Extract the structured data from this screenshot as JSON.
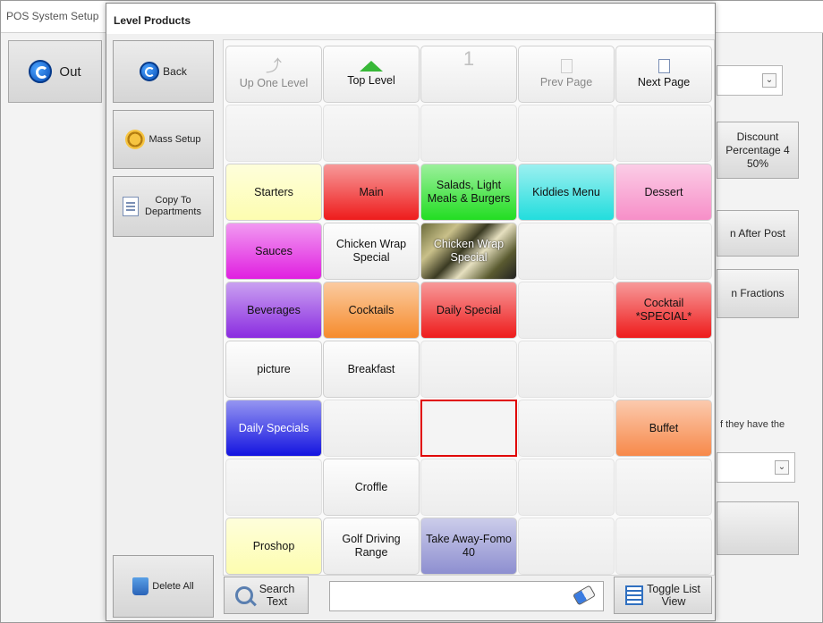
{
  "background_window": {
    "title": "POS System Setup",
    "out_label": "Out",
    "discount_tile": "Discount\nPercentage 4\n50%",
    "after_post_tile": "n After Post",
    "fractions_tile": "n Fractions",
    "have_text": "f they have the"
  },
  "dialog": {
    "title": "Level Products",
    "left_buttons": {
      "back": "Back",
      "mass_setup": "Mass Setup",
      "copy_to_departments": "Copy To Departments",
      "delete_all": "Delete All"
    },
    "nav": {
      "up_one_level": "Up One Level",
      "top_level": "Top Level",
      "page_number": "1",
      "prev_page": "Prev Page",
      "next_page": "Next Page"
    },
    "grid_rows": [
      [
        {
          "label": "",
          "color": ""
        },
        {
          "label": "",
          "color": ""
        },
        {
          "label": "",
          "color": ""
        },
        {
          "label": "",
          "color": ""
        },
        {
          "label": "",
          "color": ""
        }
      ],
      [
        {
          "label": "Starters",
          "color": "#fdfdb0"
        },
        {
          "label": "Main",
          "color": "#ee1c1c"
        },
        {
          "label": "Salads, Light Meals & Burgers",
          "color": "#22dd22"
        },
        {
          "label": "Kiddies Menu",
          "color": "#22dddd"
        },
        {
          "label": "Dessert",
          "color": "#f78fc8"
        }
      ],
      [
        {
          "label": "Sauces",
          "color": "#e01fe0"
        },
        {
          "label": "Chicken Wrap Special",
          "color": ""
        },
        {
          "label": "Chicken Wrap Special",
          "color": "image"
        },
        {
          "label": "",
          "color": ""
        },
        {
          "label": "",
          "color": ""
        }
      ],
      [
        {
          "label": "Beverages",
          "color": "#8a2ce0"
        },
        {
          "label": "Cocktails",
          "color": "#f68b2c"
        },
        {
          "label": "Daily Special",
          "color": "#ee1c1c"
        },
        {
          "label": "",
          "color": ""
        },
        {
          "label": "Cocktail *SPECIAL*",
          "color": "#ee1c1c"
        }
      ],
      [
        {
          "label": "picture",
          "color": ""
        },
        {
          "label": "Breakfast",
          "color": ""
        },
        {
          "label": "",
          "color": ""
        },
        {
          "label": "",
          "color": ""
        },
        {
          "label": "",
          "color": ""
        }
      ],
      [
        {
          "label": "Daily Specials",
          "color": "#1414e0"
        },
        {
          "label": "",
          "color": ""
        },
        {
          "label": "",
          "color": "selected"
        },
        {
          "label": "",
          "color": ""
        },
        {
          "label": "Buffet",
          "color": "#f7894a"
        }
      ],
      [
        {
          "label": "",
          "color": ""
        },
        {
          "label": "Croffle",
          "color": ""
        },
        {
          "label": "",
          "color": ""
        },
        {
          "label": "",
          "color": ""
        },
        {
          "label": "",
          "color": ""
        }
      ],
      [
        {
          "label": "Proshop",
          "color": "#fdfdb0"
        },
        {
          "label": "Golf Driving Range",
          "color": ""
        },
        {
          "label": "Take Away-Fomo 40",
          "color": "#8d8fd0"
        },
        {
          "label": "",
          "color": ""
        },
        {
          "label": "",
          "color": ""
        }
      ]
    ],
    "bottom": {
      "search_label": "Search Text",
      "search_value": "",
      "toggle_label": "Toggle List View"
    }
  }
}
